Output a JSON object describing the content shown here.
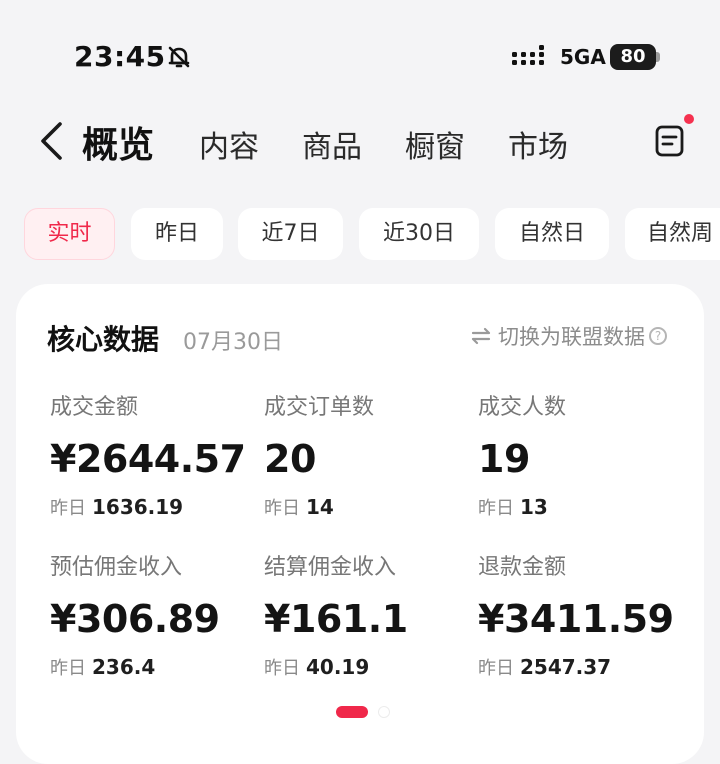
{
  "status_bar": {
    "time": "23:45",
    "network": "5GA",
    "battery": "80"
  },
  "nav": {
    "active_tab": "概览",
    "tabs": [
      "内容",
      "商品",
      "橱窗",
      "市场"
    ]
  },
  "filters": [
    "实时",
    "昨日",
    "近7日",
    "近30日",
    "自然日",
    "自然周"
  ],
  "card": {
    "title": "核心数据",
    "date": "07月30日",
    "switch_label": "切换为联盟数据",
    "help_glyph": "?",
    "prev_label": "昨日",
    "metrics": [
      {
        "label": "成交金额",
        "value": "¥2644.57",
        "prev": "1636.19"
      },
      {
        "label": "成交订单数",
        "value": "20",
        "prev": "14"
      },
      {
        "label": "成交人数",
        "value": "19",
        "prev": "13"
      },
      {
        "label": "预估佣金收入",
        "value": "¥306.89",
        "prev": "236.4"
      },
      {
        "label": "结算佣金收入",
        "value": "¥161.1",
        "prev": "40.19"
      },
      {
        "label": "退款金额",
        "value": "¥3411.59",
        "prev": "2547.37"
      }
    ]
  },
  "colors": {
    "accent": "#f0284a",
    "background": "#f4f4f6",
    "card": "#ffffff"
  },
  "icons": [
    "bell-off-icon",
    "signal-icon",
    "battery-icon",
    "back-chevron-icon",
    "document-icon",
    "swap-icon",
    "help-icon"
  ]
}
